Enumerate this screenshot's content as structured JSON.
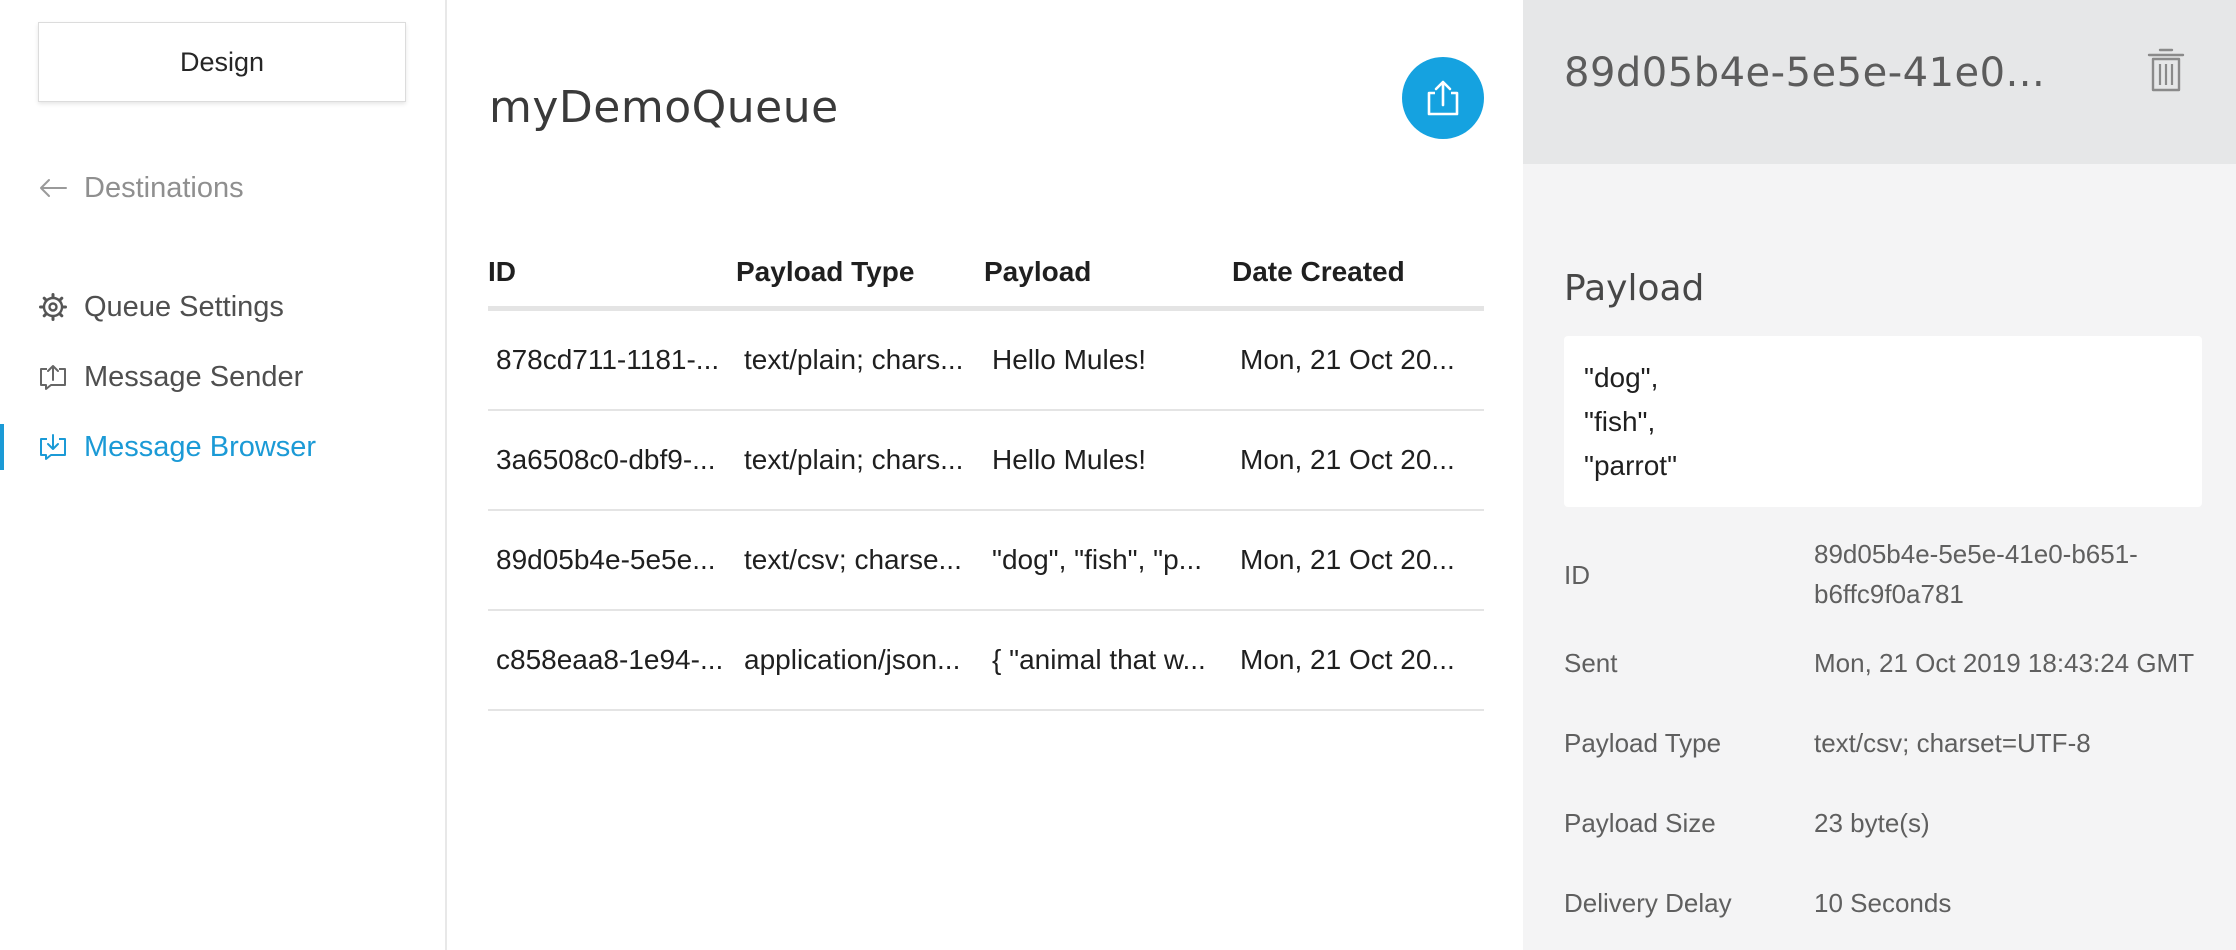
{
  "sidebar": {
    "design_label": "Design",
    "back_label": "Destinations",
    "items": [
      {
        "label": "Queue Settings",
        "icon": "gear-icon",
        "active": false
      },
      {
        "label": "Message Sender",
        "icon": "message-send-icon",
        "active": false
      },
      {
        "label": "Message Browser",
        "icon": "message-browse-icon",
        "active": true
      }
    ]
  },
  "main": {
    "title": "myDemoQueue",
    "export_icon": "export-upload-icon",
    "table": {
      "headers": [
        "ID",
        "Payload Type",
        "Payload",
        "Date Created"
      ],
      "rows": [
        [
          "878cd711-1181-...",
          "text/plain; chars...",
          "Hello Mules!",
          "Mon, 21 Oct 20..."
        ],
        [
          "3a6508c0-dbf9-...",
          "text/plain; chars...",
          "Hello Mules!",
          "Mon, 21 Oct 20..."
        ],
        [
          "89d05b4e-5e5e...",
          "text/csv; charse...",
          "\"dog\", \"fish\", \"p...",
          "Mon, 21 Oct 20..."
        ],
        [
          "c858eaa8-1e94-...",
          "application/json...",
          "{ \"animal that w...",
          "Mon, 21 Oct 20..."
        ]
      ]
    }
  },
  "detail": {
    "title": "89d05b4e-5e5e-41e0...",
    "delete_icon": "trash-icon",
    "payload_heading": "Payload",
    "payload_lines": [
      "\"dog\",",
      "\"fish\",",
      "\"parrot\""
    ],
    "fields": [
      {
        "key": "ID",
        "value_lines": [
          "89d05b4e-5e5e-41e0-b651-",
          "b6ffc9f0a781"
        ]
      },
      {
        "key": "Sent",
        "value_lines": [
          "Mon, 21 Oct 2019 18:43:24 GMT"
        ]
      },
      {
        "key": "Payload Type",
        "value_lines": [
          "text/csv; charset=UTF-8"
        ]
      },
      {
        "key": "Payload Size",
        "value_lines": [
          "23 byte(s)"
        ]
      },
      {
        "key": "Delivery Delay",
        "value_lines": [
          "10 Seconds"
        ]
      }
    ]
  },
  "colors": {
    "accent": "#1b9ad6",
    "export_button": "#15a2e0",
    "detail_background": "#f4f4f5",
    "detail_header": "#e6e7e8"
  }
}
